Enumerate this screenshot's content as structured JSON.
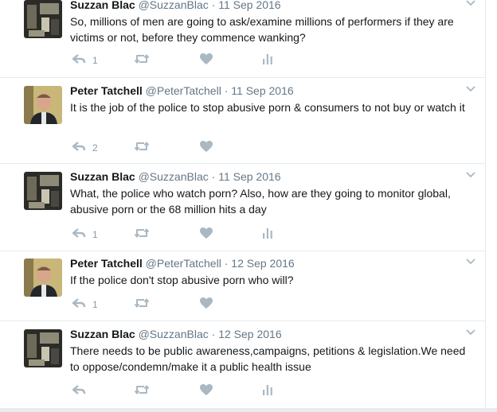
{
  "tweets": [
    {
      "name": "Suzzan Blac",
      "handle": "@SuzzanBlac",
      "date": "11 Sep 2016",
      "text": "So, millions of men are going to ask/examine millions of performers if they are victims or not, before they commence wanking?",
      "replies": "1",
      "avatar": "suzzan"
    },
    {
      "name": "Peter Tatchell",
      "handle": "@PeterTatchell",
      "date": "11 Sep 2016",
      "text": "It is the job of the police to stop abusive porn & consumers to not buy or watch it",
      "replies": "2",
      "avatar": "peter"
    },
    {
      "name": "Suzzan Blac",
      "handle": "@SuzzanBlac",
      "date": "11 Sep 2016",
      "text": "What, the police who watch porn? Also, how are they going to monitor global, abusive porn or the 68 million hits a day",
      "replies": "1",
      "avatar": "suzzan"
    },
    {
      "name": "Peter Tatchell",
      "handle": "@PeterTatchell",
      "date": "12 Sep 2016",
      "text": "If the police don't stop abusive porn who will?",
      "replies": "1",
      "avatar": "peter"
    },
    {
      "name": "Suzzan Blac",
      "handle": "@SuzzanBlac",
      "date": "12 Sep 2016",
      "text": "There needs to be public awareness,campaigns, petitions & legislation.We need to oppose/condemn/make it a public health issue",
      "replies": "",
      "avatar": "suzzan"
    }
  ],
  "separator": "·",
  "colors": {
    "icon": "#aab8c2",
    "muted": "#657786",
    "text": "#14171a"
  },
  "icons": {
    "reply": "reply-icon",
    "retweet": "retweet-icon",
    "like": "heart-icon",
    "analytics": "analytics-icon",
    "more": "chevron-down-icon"
  }
}
